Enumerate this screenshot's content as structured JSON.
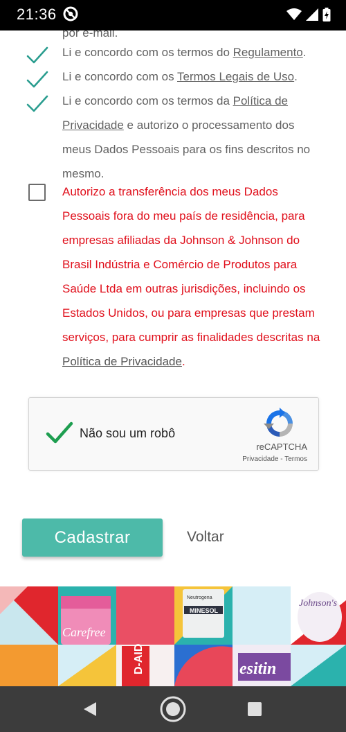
{
  "status_bar": {
    "time": "21:36",
    "icons": [
      "at-sign-icon",
      "wifi-icon",
      "cell-signal-icon",
      "battery-icon"
    ]
  },
  "cut_text": "por e-mail.",
  "consents": [
    {
      "checked": true,
      "prefix": "Li e concordo com os termos do ",
      "link": "Regulamento",
      "suffix": "."
    },
    {
      "checked": true,
      "prefix": "Li e concordo com os ",
      "link": "Termos Legais de Uso",
      "suffix": "."
    },
    {
      "checked": true,
      "prefix": "Li e concordo com os termos da ",
      "link": "Política de Privacidade",
      "suffix": " e autorizo o processamento dos meus Dados Pessoais para os fins descritos no mesmo."
    },
    {
      "checked": false,
      "prefix": "Autorizo a transferência dos meus Dados Pessoais fora do meu país de residência, para empresas afiliadas da Johnson & Johnson do Brasil Indústria e Comércio de Produtos para Saúde Ltda em outras jurisdições, incluindo os Estados Unidos, ou para empresas que prestam serviços, para cumprir as finalidades descritas na ",
      "link": "Política de Privacidade",
      "suffix": "."
    }
  ],
  "recaptcha": {
    "checked": true,
    "label": "Não sou um robô",
    "brand": "reCAPTCHA",
    "privacy": "Privacidade",
    "separator": " - ",
    "terms": "Termos"
  },
  "actions": {
    "submit": "Cadastrar",
    "back": "Voltar"
  },
  "banner_text": {
    "carefree": "Carefree",
    "minesol": "MINESOL",
    "neutrogena": "Neutrogena",
    "johnsons": "Johnson's",
    "bandaid": "D-AID",
    "desitin": "esitin"
  },
  "colors": {
    "accent": "#4dbaa9",
    "check": "#2a9d8f",
    "alert_text": "#e00f1b",
    "body_text": "#616161"
  },
  "nav_bar": {
    "buttons": [
      "back-icon",
      "home-icon",
      "recents-icon"
    ]
  }
}
